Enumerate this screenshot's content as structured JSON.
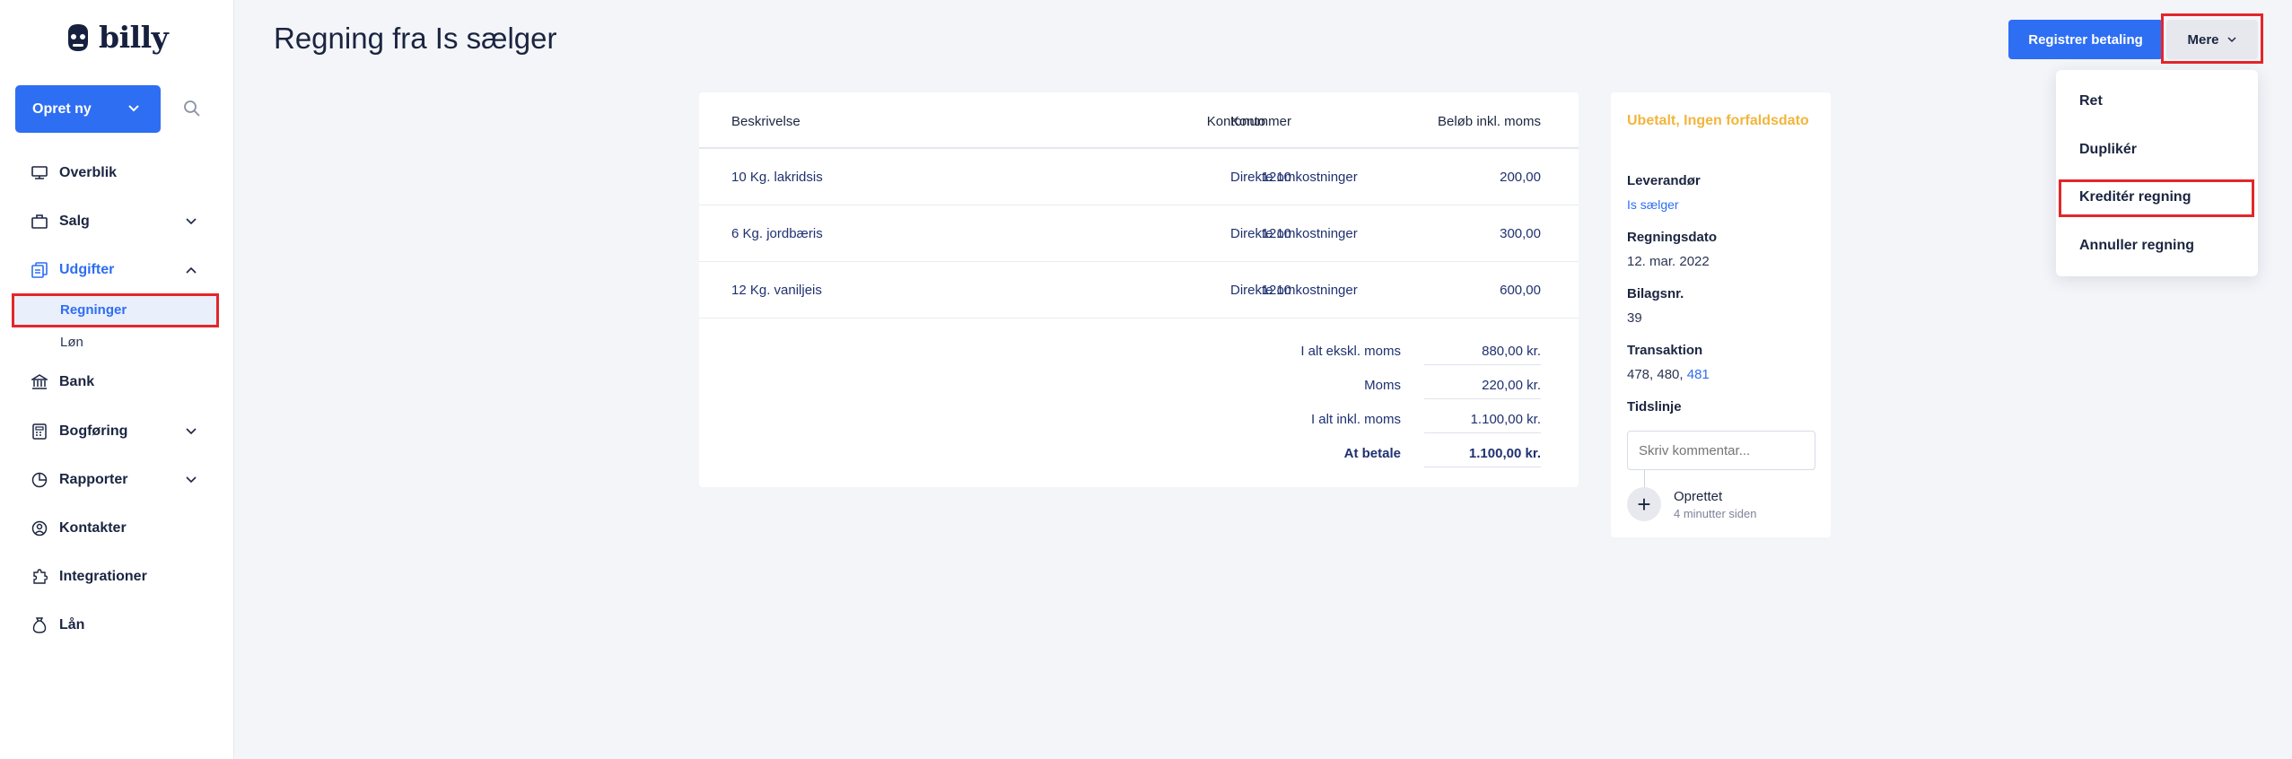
{
  "app": {
    "logo_text": "billy"
  },
  "sidebar": {
    "create_label": "Opret ny",
    "items": [
      {
        "label": "Overblik",
        "icon": "monitor-icon"
      },
      {
        "label": "Salg",
        "icon": "sales-icon"
      },
      {
        "label": "Udgifter",
        "icon": "expenses-icon"
      },
      {
        "label": "Bank",
        "icon": "bank-icon"
      },
      {
        "label": "Bogføring",
        "icon": "calculator-icon"
      },
      {
        "label": "Rapporter",
        "icon": "reports-icon"
      },
      {
        "label": "Kontakter",
        "icon": "contacts-icon"
      },
      {
        "label": "Integrationer",
        "icon": "puzzle-icon"
      },
      {
        "label": "Lån",
        "icon": "money-bag-icon"
      }
    ],
    "subitems": [
      {
        "label": "Regninger"
      },
      {
        "label": "Løn"
      }
    ]
  },
  "header": {
    "title": "Regning fra Is sælger",
    "register_payment": "Registrer betaling",
    "more": "Mere"
  },
  "dropdown": {
    "items": [
      "Ret",
      "Duplikér",
      "Kreditér regning",
      "Annuller regning"
    ]
  },
  "table": {
    "headers": [
      "Beskrivelse",
      "Kontonummer",
      "Konto",
      "Beløb inkl. moms"
    ],
    "rows": [
      {
        "desc": "10 Kg. lakridsis",
        "account_no": "1210",
        "account": "Direkte omkostninger",
        "amount": "200,00"
      },
      {
        "desc": "6 Kg. jordbæris",
        "account_no": "1210",
        "account": "Direkte omkostninger",
        "amount": "300,00"
      },
      {
        "desc": "12 Kg. vaniljeis",
        "account_no": "1210",
        "account": "Direkte omkostninger",
        "amount": "600,00"
      }
    ],
    "totals": [
      {
        "label": "I alt ekskl. moms",
        "value": "880,00 kr."
      },
      {
        "label": "Moms",
        "value": "220,00 kr."
      },
      {
        "label": "I alt inkl. moms",
        "value": "1.100,00 kr."
      },
      {
        "label": "At betale",
        "value": "1.100,00 kr."
      }
    ]
  },
  "info": {
    "status": "Ubetalt, Ingen forfaldsdato",
    "supplier_label": "Leverandør",
    "supplier": "Is sælger",
    "date_label": "Regningsdato",
    "date": "12. mar. 2022",
    "voucher_label": "Bilagsnr.",
    "voucher": "39",
    "transaction_label": "Transaktion",
    "transactions_plain": "478, 480,",
    "transaction_link": "481",
    "timeline_label": "Tidslinje",
    "comment_placeholder": "Skriv kommentar...",
    "event_title": "Oprettet",
    "event_time": "4 minutter siden"
  },
  "colors": {
    "accent": "#2e6ef2",
    "status": "#f2b53c",
    "highlight": "#e3262b"
  }
}
